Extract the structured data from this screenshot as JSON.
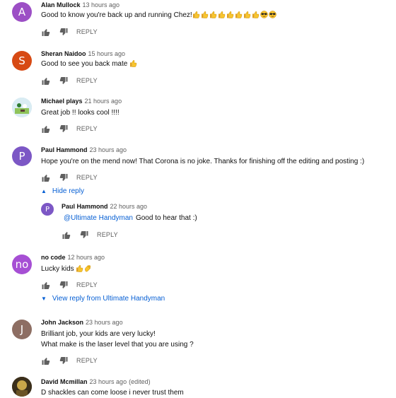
{
  "reply_label": "REPLY",
  "comments": [
    {
      "avatar_letter": "A",
      "avatar_color": "#9c4fc5",
      "author": "Alan Mullock",
      "time": "13 hours ago",
      "text": "Good to know you're back up and running Chez!",
      "emoji": [
        "thumbs-up-emoji",
        "thumbs-up-emoji",
        "thumbs-up-emoji",
        "thumbs-up-emoji",
        "thumbs-up-emoji",
        "thumbs-up-emoji",
        "thumbs-up-emoji",
        "thumbs-up-emoji",
        "sunglasses-emoji",
        "sunglasses-emoji"
      ]
    },
    {
      "avatar_letter": "S",
      "avatar_color": "#d74a14",
      "author": "Sheran Naidoo",
      "time": "15 hours ago",
      "text": "Good to see you back mate",
      "emoji": [
        "thumbs-up-emoji"
      ]
    },
    {
      "avatar_letter": "",
      "avatar_color": "#bcd8e6",
      "author": "Michael plays",
      "time": "21 hours ago",
      "text": "Great job !!  looks cool !!!!"
    },
    {
      "avatar_letter": "P",
      "avatar_color": "#7c57c5",
      "author": "Paul Hammond",
      "time": "23 hours ago",
      "text": "Hope you're on the mend now! That Corona is no joke. Thanks for finishing off the editing and posting :)",
      "toggle": "Hide reply",
      "reply": {
        "avatar_letter": "P",
        "avatar_color": "#7c57c5",
        "author": "Paul Hammond",
        "time": "22 hours ago",
        "mention": "@Ultimate Handyman",
        "text": "Good to hear that :)"
      }
    },
    {
      "avatar_letter": "no",
      "avatar_color": "#a64fd4",
      "author": "no code",
      "time": "12 hours ago",
      "text": "Lucky  kids",
      "emoji": [
        "thumbs-up-emoji",
        "clapping-emoji"
      ],
      "toggle": "View reply from Ultimate Handyman"
    },
    {
      "avatar_letter": "J",
      "avatar_color": "#8d6e63",
      "author": "John Jackson",
      "time": "23 hours ago",
      "text": "Brilliant job, your kids are very lucky!",
      "text2": "What make is the laser level that you are using ?"
    },
    {
      "avatar_letter": "",
      "avatar_color": "#5a4a2a",
      "author": "David Mcmillan",
      "time": "23 hours ago",
      "edited": "(edited)",
      "text": "D shackles can come loose i never trust them"
    }
  ]
}
